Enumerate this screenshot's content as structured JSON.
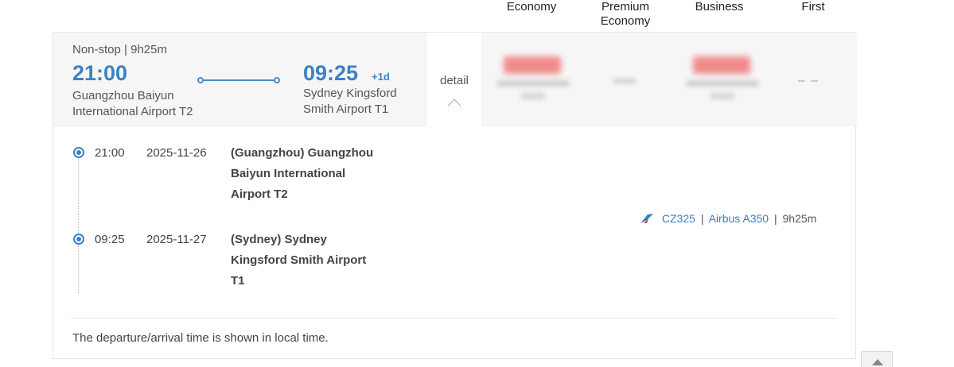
{
  "columns": {
    "economy": "Economy",
    "premium_line1": "Premium",
    "premium_line2": "Economy",
    "business": "Business",
    "first": "First"
  },
  "summary": {
    "stops": "Non-stop | 9h25m",
    "departure_time": "21:00",
    "departure_airport": "Guangzhou Baiyun International Airport T2",
    "arrival_time": "09:25",
    "plus_day": "+1d",
    "arrival_airport": "Sydney Kingsford Smith Airport T1",
    "detail_label": "detail"
  },
  "prices": {
    "first": "– –"
  },
  "segments": [
    {
      "time": "21:00",
      "date": "2025-11-26",
      "airport": "(Guangzhou) Guangzhou Baiyun International Airport T2"
    },
    {
      "time": "09:25",
      "date": "2025-11-27",
      "airport": "(Sydney) Sydney Kingsford Smith Airport T1"
    }
  ],
  "flight": {
    "number": "CZ325",
    "aircraft": "Airbus A350",
    "duration": "9h25m",
    "separator": "|"
  },
  "note": "The departure/arrival time is shown in local time.",
  "colors": {
    "accent": "#3a82c5",
    "airline_logo": "#2f7fc6"
  },
  "icons": {
    "airline": "airline-logo-icon",
    "chevron": "chevron-up-icon",
    "back_to_top": "arrow-up-icon"
  }
}
